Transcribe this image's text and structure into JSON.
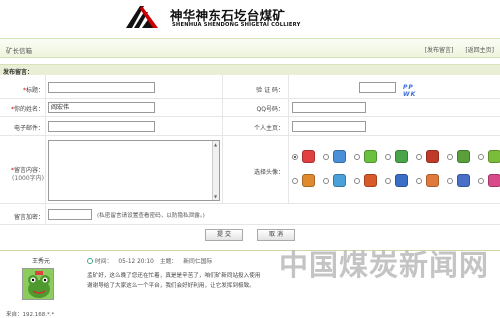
{
  "header": {
    "brand_cn": "神华神东石圪台煤矿",
    "brand_en": "SHENHUA SHENDONG SHIGETAI COLLIERY"
  },
  "title_bar": {
    "title": "矿长信箱",
    "links": [
      "[发布留言]",
      "[返回主页]"
    ]
  },
  "section": {
    "title": "发布留言："
  },
  "form": {
    "title_label": "标题：",
    "title_value": "",
    "captcha_label": "验 证 码：",
    "captcha_value": "",
    "captcha_image_text": "PP WK",
    "name_label": "你的姓名：",
    "name_value": "阎宏伟",
    "qq_label": "QQ号码：",
    "qq_value": "",
    "email_label": "电子邮件：",
    "email_value": "",
    "homepage_label": "个人主页：",
    "homepage_value": "",
    "content_label": "留言内容：",
    "content_sub": "(1000字内)",
    "content_value": "",
    "avatar_label": "选择头像：",
    "password_label": "留言加密：",
    "password_value": "",
    "password_hint": "(私密留言请设置查看密码，以防隐私泄露。)",
    "submit_label": "提 交",
    "cancel_label": "取 消"
  },
  "avatar_colors": [
    [
      "#e04040",
      "#4a8fd8",
      "#6cc040",
      "#4aa54a",
      "#c03a2a",
      "#5a9f3a",
      "#7abd3a"
    ],
    [
      "#e08a30",
      "#4aa0d8",
      "#d85a2a",
      "#3a6fc8",
      "#e07a3a",
      "#4a6fc8",
      "#d84a8a"
    ]
  ],
  "message": {
    "author": "王秀元",
    "ip": "来自：192.168.*.*",
    "time_label": "时间：",
    "time_value": "05-12 20:10",
    "subject_label": "主题：",
    "subject_value": "新同仁国际",
    "body_lines": [
      "孟矿好，这么晚了您还在忙着，真是是辛苦了，咱们矿新同站投入使用",
      "谢谢导给了大家这么一个平台，我们会好好利用，让它发挥到极致。"
    ]
  },
  "watermark": "中国煤炭新闻网"
}
